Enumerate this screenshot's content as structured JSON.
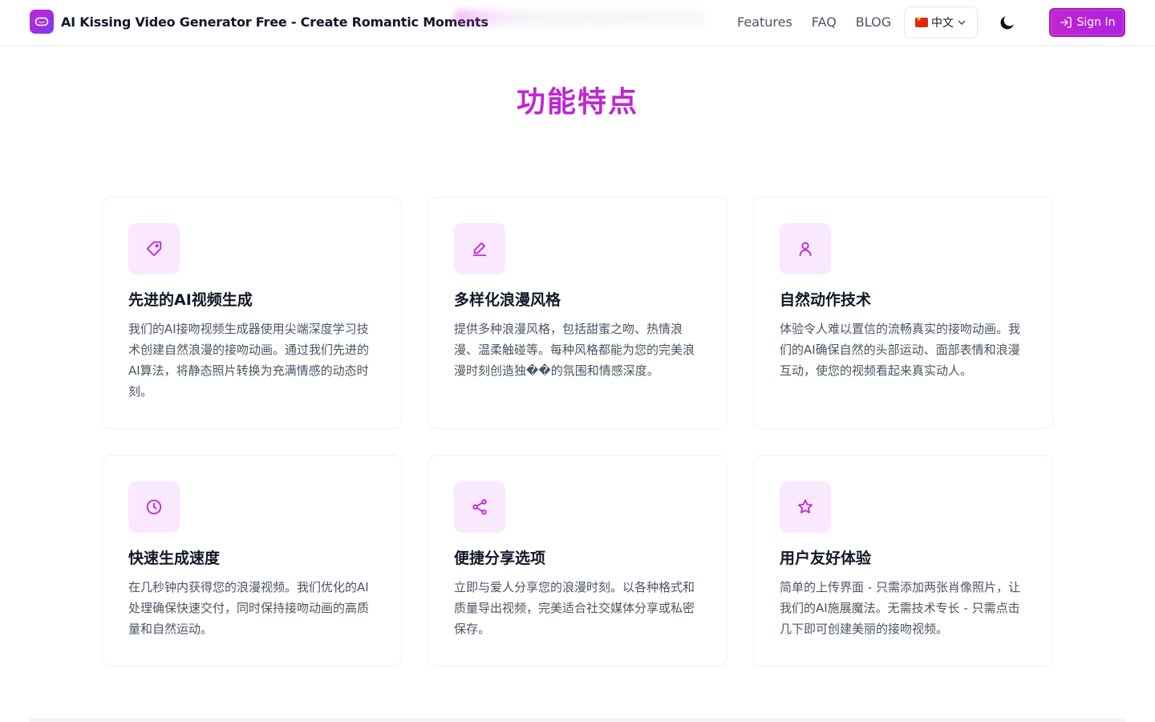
{
  "header": {
    "brand_title": "AI Kissing Video Generator Free - Create Romantic Moments",
    "nav": [
      "Features",
      "FAQ",
      "BLOG"
    ],
    "language": "中文",
    "signin_label": "Sign In"
  },
  "section": {
    "title": "功能特点"
  },
  "features": [
    {
      "icon": "tag-icon",
      "title": "先进的AI视频生成",
      "desc": "我们的AI接吻视频生成器使用尖端深度学习技术创建自然浪漫的接吻动画。通过我们先进的AI算法，将静态照片转换为充满情感的动态时刻。"
    },
    {
      "icon": "pen-icon",
      "title": "多样化浪漫风格",
      "desc": "提供多种浪漫风格，包括甜蜜之吻、热情浪漫、温柔触碰等。每种风格都能为您的完美浪漫时刻创造独��的氛围和情感深度。"
    },
    {
      "icon": "user-icon",
      "title": "自然动作技术",
      "desc": "体验令人难以置信的流畅真实的接吻动画。我们的AI确保自然的头部运动、面部表情和浪漫互动，使您的视频看起来真实动人。"
    },
    {
      "icon": "clock-icon",
      "title": "快速生成速度",
      "desc": "在几秒钟内获得您的浪漫视频。我们优化的AI处理确保快速交付，同时保持接吻动画的高质量和自然运动。"
    },
    {
      "icon": "share-icon",
      "title": "便捷分享选项",
      "desc": "立即与爱人分享您的浪漫时刻。以各种格式和质量导出视频，完美适合社交媒体分享或私密保存。"
    },
    {
      "icon": "star-icon",
      "title": "用户友好体验",
      "desc": "简单的上传界面 - 只需添加两张肖像照片，让我们的AI施展魔法。无需技术专长 - 只需点击几下即可创建美丽的接吻视频。"
    }
  ],
  "colors": {
    "accent": "#c026d3",
    "icon_bg": "#fae8ff",
    "text": "#111827",
    "muted": "#4b5563"
  }
}
